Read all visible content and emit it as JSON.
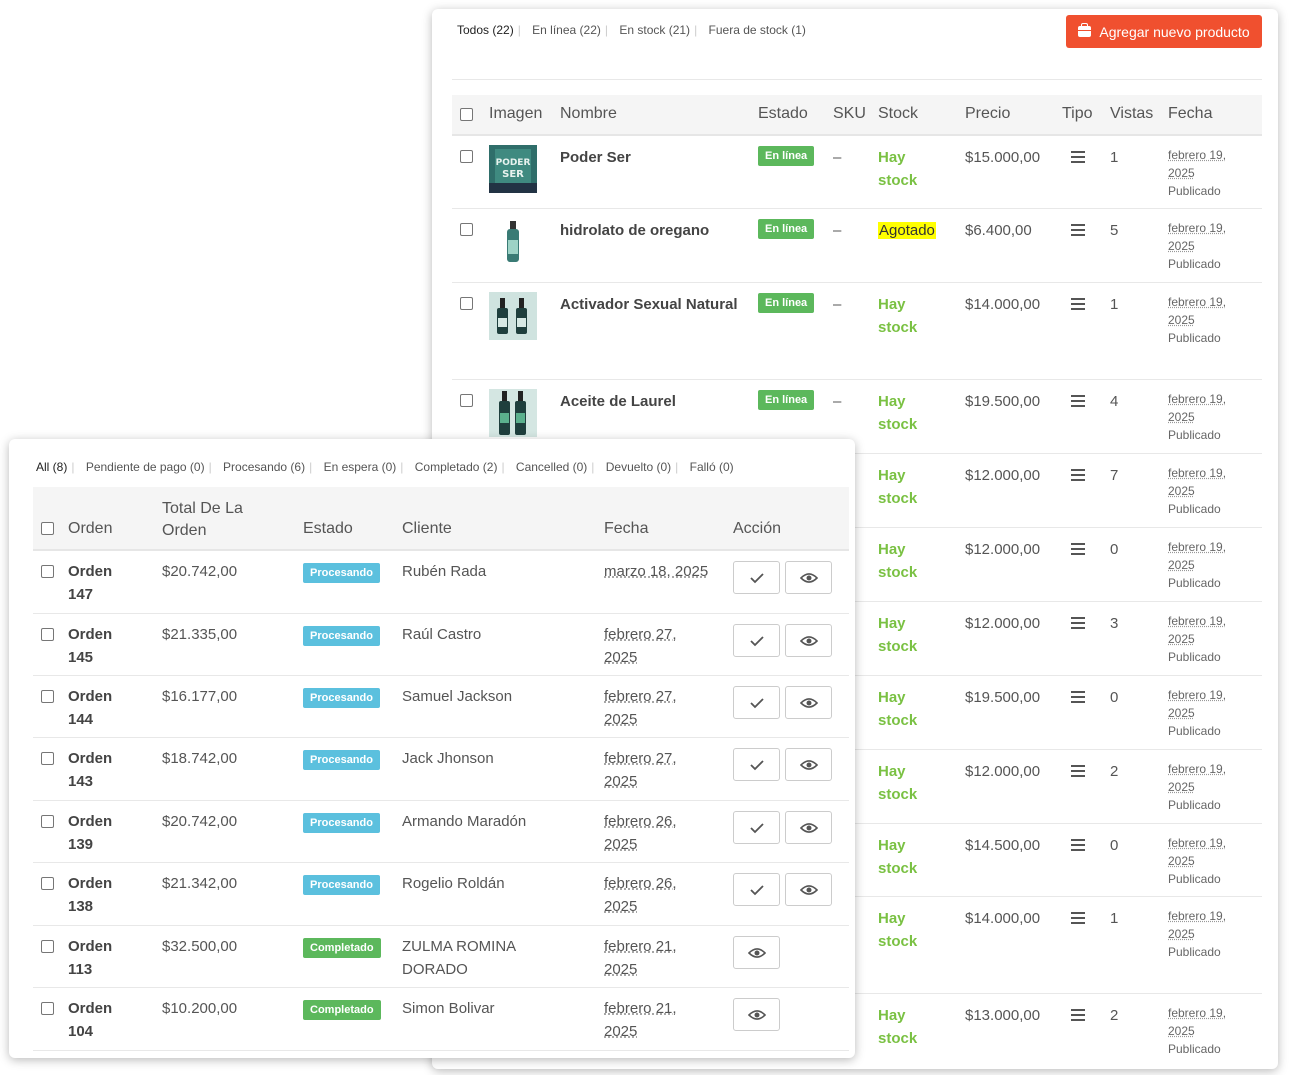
{
  "products": {
    "filters": [
      {
        "label": "Todos (22)"
      },
      {
        "label": "En línea (22)"
      },
      {
        "label": "En stock (21)"
      },
      {
        "label": "Fuera de stock (1)"
      }
    ],
    "add_button_label": "Agregar nuevo producto",
    "columns": [
      "Imagen",
      "Nombre",
      "Estado",
      "SKU",
      "Stock",
      "Precio",
      "Tipo",
      "Vistas",
      "Fecha"
    ],
    "rows": [
      {
        "name": "Poder Ser",
        "status": "En línea",
        "sku": "–",
        "stock": "Hay stock",
        "price": "$15.000,00",
        "views": "1",
        "date1": "febrero 19,",
        "date2": "2025",
        "state": "Publicado"
      },
      {
        "name": "hidrolato de oregano",
        "status": "En línea",
        "sku": "–",
        "stock": "Agotado",
        "price": "$6.400,00",
        "views": "5",
        "date1": "febrero 19,",
        "date2": "2025",
        "state": "Publicado"
      },
      {
        "name": "Activador Sexual Natural",
        "status": "En línea",
        "sku": "–",
        "stock": "Hay stock",
        "price": "$14.000,00",
        "views": "1",
        "date1": "febrero 19,",
        "date2": "2025",
        "state": "Publicado"
      },
      {
        "name": "Aceite de Laurel",
        "status": "En línea",
        "sku": "–",
        "stock": "Hay stock",
        "price": "$19.500,00",
        "views": "4",
        "date1": "febrero 19,",
        "date2": "2025",
        "state": "Publicado"
      },
      {
        "name": "",
        "status": "",
        "sku": "",
        "stock": "Hay stock",
        "price": "$12.000,00",
        "views": "7",
        "date1": "febrero 19,",
        "date2": "2025",
        "state": "Publicado"
      },
      {
        "name": "",
        "status": "",
        "sku": "",
        "stock": "Hay stock",
        "price": "$12.000,00",
        "views": "0",
        "date1": "febrero 19,",
        "date2": "2025",
        "state": "Publicado"
      },
      {
        "name": "",
        "status": "",
        "sku": "",
        "stock": "Hay stock",
        "price": "$12.000,00",
        "views": "3",
        "date1": "febrero 19,",
        "date2": "2025",
        "state": "Publicado"
      },
      {
        "name": "",
        "status": "",
        "sku": "",
        "stock": "Hay stock",
        "price": "$19.500,00",
        "views": "0",
        "date1": "febrero 19,",
        "date2": "2025",
        "state": "Publicado"
      },
      {
        "name": "",
        "status": "",
        "sku": "",
        "stock": "Hay stock",
        "price": "$12.000,00",
        "views": "2",
        "date1": "febrero 19,",
        "date2": "2025",
        "state": "Publicado"
      },
      {
        "name": "",
        "status": "",
        "sku": "",
        "stock": "Hay stock",
        "price": "$14.500,00",
        "views": "0",
        "date1": "febrero 19,",
        "date2": "2025",
        "state": "Publicado"
      },
      {
        "name": "",
        "status": "",
        "sku": "",
        "stock": "Hay stock",
        "price": "$14.000,00",
        "views": "1",
        "date1": "febrero 19,",
        "date2": "2025",
        "state": "Publicado"
      },
      {
        "name": "",
        "status": "",
        "sku": "",
        "stock": "Hay stock",
        "price": "$13.000,00",
        "views": "2",
        "date1": "febrero 19,",
        "date2": "2025",
        "state": "Publicado"
      }
    ]
  },
  "orders": {
    "filters": [
      {
        "label": "All (8)"
      },
      {
        "label": "Pendiente de pago (0)"
      },
      {
        "label": "Procesando (6)"
      },
      {
        "label": "En espera (0)"
      },
      {
        "label": "Completado (2)"
      },
      {
        "label": "Cancelled (0)"
      },
      {
        "label": "Devuelto (0)"
      },
      {
        "label": "Falló (0)"
      }
    ],
    "columns": {
      "order": "Orden",
      "total1": "Total De La",
      "total2": "Orden",
      "status": "Estado",
      "client": "Cliente",
      "date": "Fecha",
      "action": "Acción"
    },
    "rows": [
      {
        "l1": "Orden",
        "l2": "147",
        "total": "$20.742,00",
        "status": "Procesando",
        "client": "Rubén Rada",
        "d1": "marzo 18, 2025",
        "d2": "",
        "complete_action": true
      },
      {
        "l1": "Orden",
        "l2": "145",
        "total": "$21.335,00",
        "status": "Procesando",
        "client": "Raúl Castro",
        "d1": "febrero 27,",
        "d2": "2025",
        "complete_action": true
      },
      {
        "l1": "Orden",
        "l2": "144",
        "total": "$16.177,00",
        "status": "Procesando",
        "client": "Samuel Jackson",
        "d1": "febrero 27,",
        "d2": "2025",
        "complete_action": true
      },
      {
        "l1": "Orden",
        "l2": "143",
        "total": "$18.742,00",
        "status": "Procesando",
        "client": "Jack Jhonson",
        "d1": "febrero 27,",
        "d2": "2025",
        "complete_action": true
      },
      {
        "l1": "Orden",
        "l2": "139",
        "total": "$20.742,00",
        "status": "Procesando",
        "client": "Armando Maradón",
        "d1": "febrero 26,",
        "d2": "2025",
        "complete_action": true
      },
      {
        "l1": "Orden",
        "l2": "138",
        "total": "$21.342,00",
        "status": "Procesando",
        "client": "Rogelio Roldán",
        "d1": "febrero 26,",
        "d2": "2025",
        "complete_action": true
      },
      {
        "l1": "Orden",
        "l2": "113",
        "total": "$32.500,00",
        "status": "Completado",
        "client": "ZULMA ROMINA DORADO",
        "d1": "febrero 21,",
        "d2": "2025",
        "complete_action": false
      },
      {
        "l1": "Orden",
        "l2": "104",
        "total": "$10.200,00",
        "status": "Completado",
        "client": "Simon Bolivar",
        "d1": "febrero 21,",
        "d2": "2025",
        "complete_action": false
      }
    ]
  }
}
